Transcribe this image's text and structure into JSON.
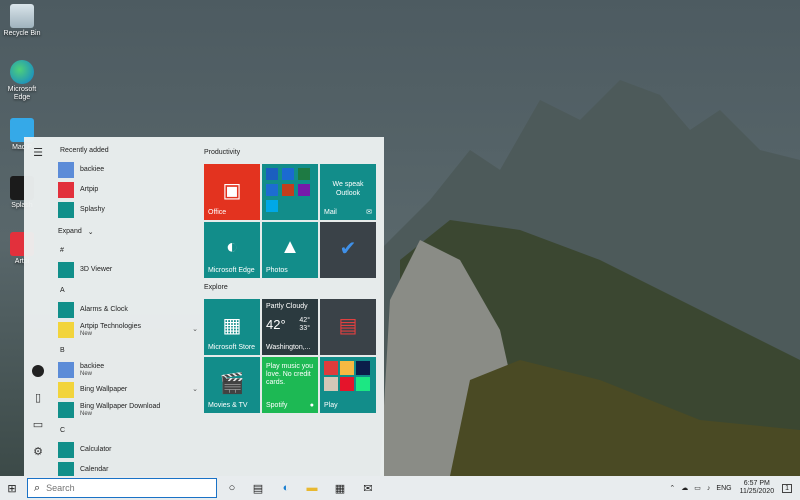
{
  "desktop": {
    "icons": [
      {
        "label": "Recycle Bin",
        "icon": "recycle-bin-icon"
      },
      {
        "label": "Microsoft Edge",
        "icon": "edge-icon"
      },
      {
        "label": "Mac P",
        "icon": "mac-folder-icon"
      },
      {
        "label": "Splash",
        "icon": "splashy-icon"
      },
      {
        "label": "Artpi",
        "icon": "artpip-icon"
      }
    ]
  },
  "start_menu": {
    "recently_added_title": "Recently added",
    "recent": [
      {
        "label": "backiee",
        "icon": "backiee-icon"
      },
      {
        "label": "Artpip",
        "icon": "artpip-icon"
      },
      {
        "label": "Splashy",
        "icon": "splashy-icon"
      }
    ],
    "expand_label": "Expand",
    "sections": [
      {
        "letter": "#",
        "apps": [
          {
            "label": "3D Viewer",
            "sub": ""
          }
        ]
      },
      {
        "letter": "A",
        "apps": [
          {
            "label": "Alarms & Clock",
            "sub": ""
          },
          {
            "label": "Artpip Technologies",
            "sub": "New"
          }
        ]
      },
      {
        "letter": "B",
        "apps": [
          {
            "label": "backiee",
            "sub": "New"
          },
          {
            "label": "Bing Wallpaper",
            "sub": ""
          },
          {
            "label": "Bing Wallpaper Download",
            "sub": "New"
          }
        ]
      },
      {
        "letter": "C",
        "apps": [
          {
            "label": "Calculator",
            "sub": ""
          },
          {
            "label": "Calendar",
            "sub": ""
          }
        ]
      }
    ],
    "groups": {
      "productivity": "Productivity",
      "explore": "Explore"
    },
    "tiles": {
      "office": "Office",
      "mail": "Mail",
      "mail_text": "We speak Outlook",
      "edge": "Microsoft Edge",
      "photos": "Photos",
      "store": "Microsoft Store",
      "weather_cond": "Partly Cloudy",
      "weather_temp": "42°",
      "weather_hi": "42°",
      "weather_lo": "33°",
      "weather_city": "Washington,...",
      "movies": "Movies & TV",
      "spotify": "Spotify",
      "spotify_text": "Play music you love. No credit cards.",
      "play": "Play"
    }
  },
  "taskbar": {
    "search_placeholder": "Search",
    "lang": "ENG",
    "time": "6:57 PM",
    "date": "11/25/2020",
    "notifications": "1"
  },
  "colors": {
    "accent": "#0f8f8a",
    "office": "#e3331f",
    "tile_teal": "#128d8a",
    "tile_dark": "#2b3a3f"
  }
}
